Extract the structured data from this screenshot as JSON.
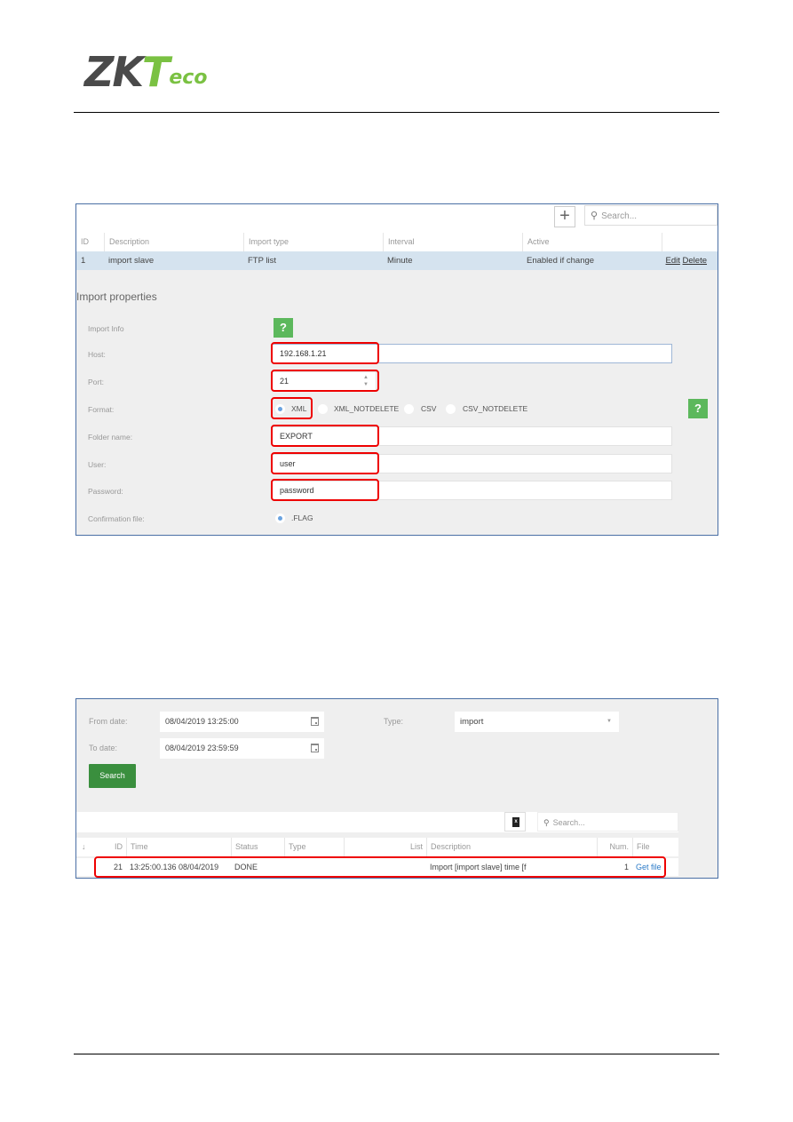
{
  "header": {
    "logo": {
      "zk": "ZK",
      "t": "T",
      "eco": "eco"
    },
    "brand_colors": {
      "dark": "#4a4a4a",
      "green": "#7ac142"
    }
  },
  "import_screen": {
    "add_icon": "plus-icon",
    "search_placeholder": "Search...",
    "columns": [
      "ID",
      "Description",
      "Import type",
      "Interval",
      "Active",
      ""
    ],
    "rows": [
      {
        "id": "1",
        "description": "import slave",
        "import_type": "FTP list",
        "interval": "Minute",
        "active": "Enabled if change",
        "edit": "Edit",
        "delete": "Delete"
      }
    ],
    "properties_title": "Import properties",
    "fields": {
      "import_info_label": "Import Info",
      "host_label": "Host:",
      "host_value": "192.168.1.21",
      "port_label": "Port:",
      "port_value": "21",
      "format_label": "Format:",
      "format_options": [
        "XML",
        "XML_NOTDELETE",
        "CSV",
        "CSV_NOTDELETE"
      ],
      "format_selected": "XML",
      "folder_label": "Folder name:",
      "folder_value": "EXPORT",
      "user_label": "User:",
      "user_value": "user",
      "password_label": "Password:",
      "password_value": "password",
      "confirmation_label": "Confirmation file:",
      "confirmation_option": ".FLAG"
    },
    "help_symbol": "?",
    "highlight_color": "#e00000"
  },
  "log_screen": {
    "from_label": "From date:",
    "from_value": "08/04/2019 13:25:00",
    "to_label": "To date:",
    "to_value": "08/04/2019 23:59:59",
    "type_label": "Type:",
    "type_value": "import",
    "search_button": "Search",
    "search_placeholder": "Search...",
    "export_icon": "excel-export-icon",
    "sort_icon": "↓",
    "columns": [
      "ID",
      "Time",
      "Status",
      "Type",
      "List",
      "Description",
      "Num.",
      "File"
    ],
    "rows": [
      {
        "id": "21",
        "time": "13:25:00.136 08/04/2019",
        "status": "DONE",
        "type": "",
        "list": "",
        "description": "Import [import slave] time [f",
        "num": "1",
        "file": "Get file"
      }
    ],
    "button_color": "#3a8f3e"
  }
}
